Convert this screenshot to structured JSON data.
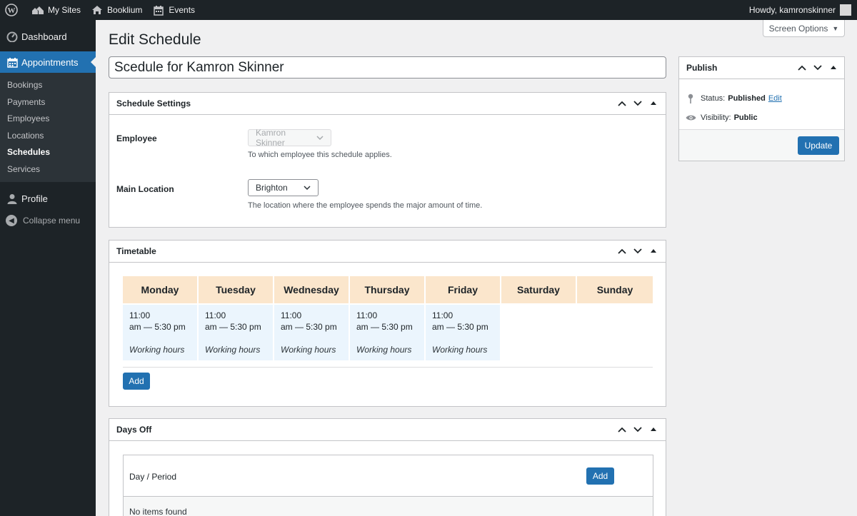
{
  "adminbar": {
    "my_sites": "My Sites",
    "site_name": "Booklium",
    "events": "Events",
    "howdy": "Howdy, kamronskinner"
  },
  "sidebar": {
    "dashboard": "Dashboard",
    "appointments": "Appointments",
    "submenu": [
      "Bookings",
      "Payments",
      "Employees",
      "Locations",
      "Schedules",
      "Services"
    ],
    "profile": "Profile",
    "collapse": "Collapse menu"
  },
  "screen_options": "Screen Options",
  "page_title": "Edit Schedule",
  "post_title": "Scedule for Kamron Skinner",
  "schedule_settings": {
    "title": "Schedule Settings",
    "employee_label": "Employee",
    "employee_value": "Kamron Skinner",
    "employee_desc": "To which employee this schedule applies.",
    "location_label": "Main Location",
    "location_value": "Brighton",
    "location_desc": "The location where the employee spends the major amount of time."
  },
  "timetable": {
    "title": "Timetable",
    "days": [
      "Monday",
      "Tuesday",
      "Wednesday",
      "Thursday",
      "Friday",
      "Saturday",
      "Sunday"
    ],
    "slots": [
      {
        "line1": "11:00",
        "line2": "am — 5:30 pm",
        "type": "Working hours"
      },
      {
        "line1": "11:00",
        "line2": "am — 5:30 pm",
        "type": "Working hours"
      },
      {
        "line1": "11:00",
        "line2": "am — 5:30 pm",
        "type": "Working hours"
      },
      {
        "line1": "11:00",
        "line2": "am — 5:30 pm",
        "type": "Working hours"
      },
      {
        "line1": "11:00",
        "line2": "am — 5:30 pm",
        "type": "Working hours"
      }
    ],
    "add_label": "Add"
  },
  "days_off": {
    "title": "Days Off",
    "column": "Day / Period",
    "add_label": "Add",
    "empty": "No items found"
  },
  "publish": {
    "title": "Publish",
    "status_label": "Status:",
    "status_value": "Published",
    "edit_link": "Edit",
    "visibility_label": "Visibility:",
    "visibility_value": "Public",
    "update_label": "Update"
  },
  "colors": {
    "accent": "#2271b1",
    "admin_dark": "#1d2327",
    "day_header": "#fbe6cc",
    "slot_bg": "#ebf5fd"
  }
}
